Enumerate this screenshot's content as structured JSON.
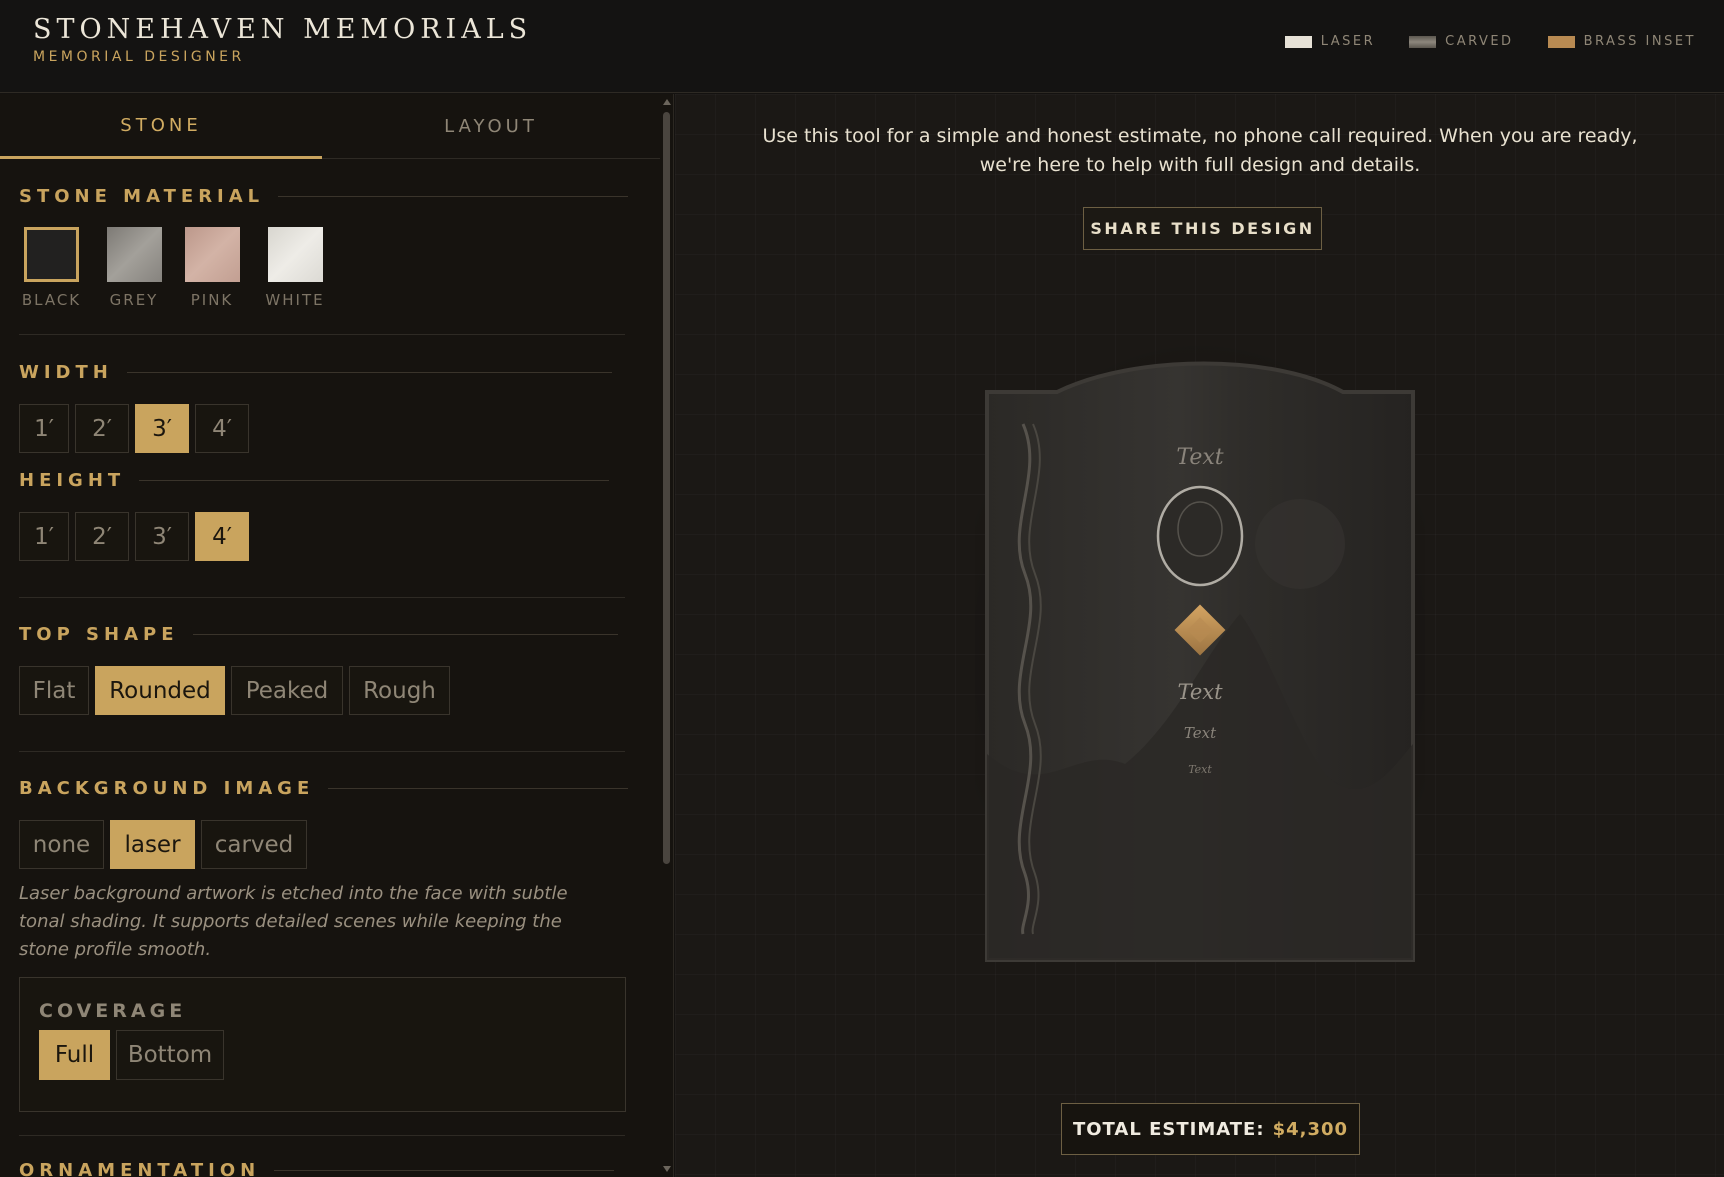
{
  "header": {
    "brand_title": "STONEHAVEN MEMORIALS",
    "brand_subtitle": "MEMORIAL DESIGNER",
    "legend": [
      {
        "label": "LASER",
        "color": "#e6e1d6"
      },
      {
        "label": "CARVED",
        "color": "#7a746b"
      },
      {
        "label": "BRASS INSET",
        "color": "#b88a52"
      }
    ]
  },
  "sidebar": {
    "tabs": [
      {
        "label": "STONE"
      },
      {
        "label": "LAYOUT"
      }
    ],
    "stone_material": {
      "title": "STONE MATERIAL",
      "options": [
        {
          "label": "BLACK",
          "color": "#222120"
        },
        {
          "label": "GREY",
          "color": "#8c8984"
        },
        {
          "label": "PINK",
          "color": "#caa79a"
        },
        {
          "label": "WHITE",
          "color": "#e4e2dc"
        }
      ],
      "selected": "BLACK"
    },
    "width": {
      "title": "WIDTH",
      "options": [
        "1′",
        "2′",
        "3′",
        "4′"
      ],
      "selected": "3′"
    },
    "height": {
      "title": "HEIGHT",
      "options": [
        "1′",
        "2′",
        "3′",
        "4′"
      ],
      "selected": "4′"
    },
    "top_shape": {
      "title": "TOP SHAPE",
      "options": [
        "Flat",
        "Rounded",
        "Peaked",
        "Rough"
      ],
      "selected": "Rounded"
    },
    "background_image": {
      "title": "BACKGROUND IMAGE",
      "options": [
        "none",
        "laser",
        "carved"
      ],
      "selected": "laser",
      "description": "Laser background artwork is etched into the face with subtle tonal shading. It supports detailed scenes while keeping the stone profile smooth."
    },
    "coverage": {
      "title": "COVERAGE",
      "options": [
        "Full",
        "Bottom"
      ],
      "selected": "Full"
    },
    "ornamentation": {
      "title": "ORNAMENTATION"
    }
  },
  "main": {
    "intro": "Use this tool for a simple and honest estimate, no phone call required. When you are ready, we're here to help with full design and details.",
    "share_label": "SHARE THIS DESIGN",
    "preview_texts": [
      "Text",
      "Text",
      "Text",
      "Text"
    ],
    "total_label": "TOTAL ESTIMATE:",
    "total_amount": "$4,300"
  }
}
